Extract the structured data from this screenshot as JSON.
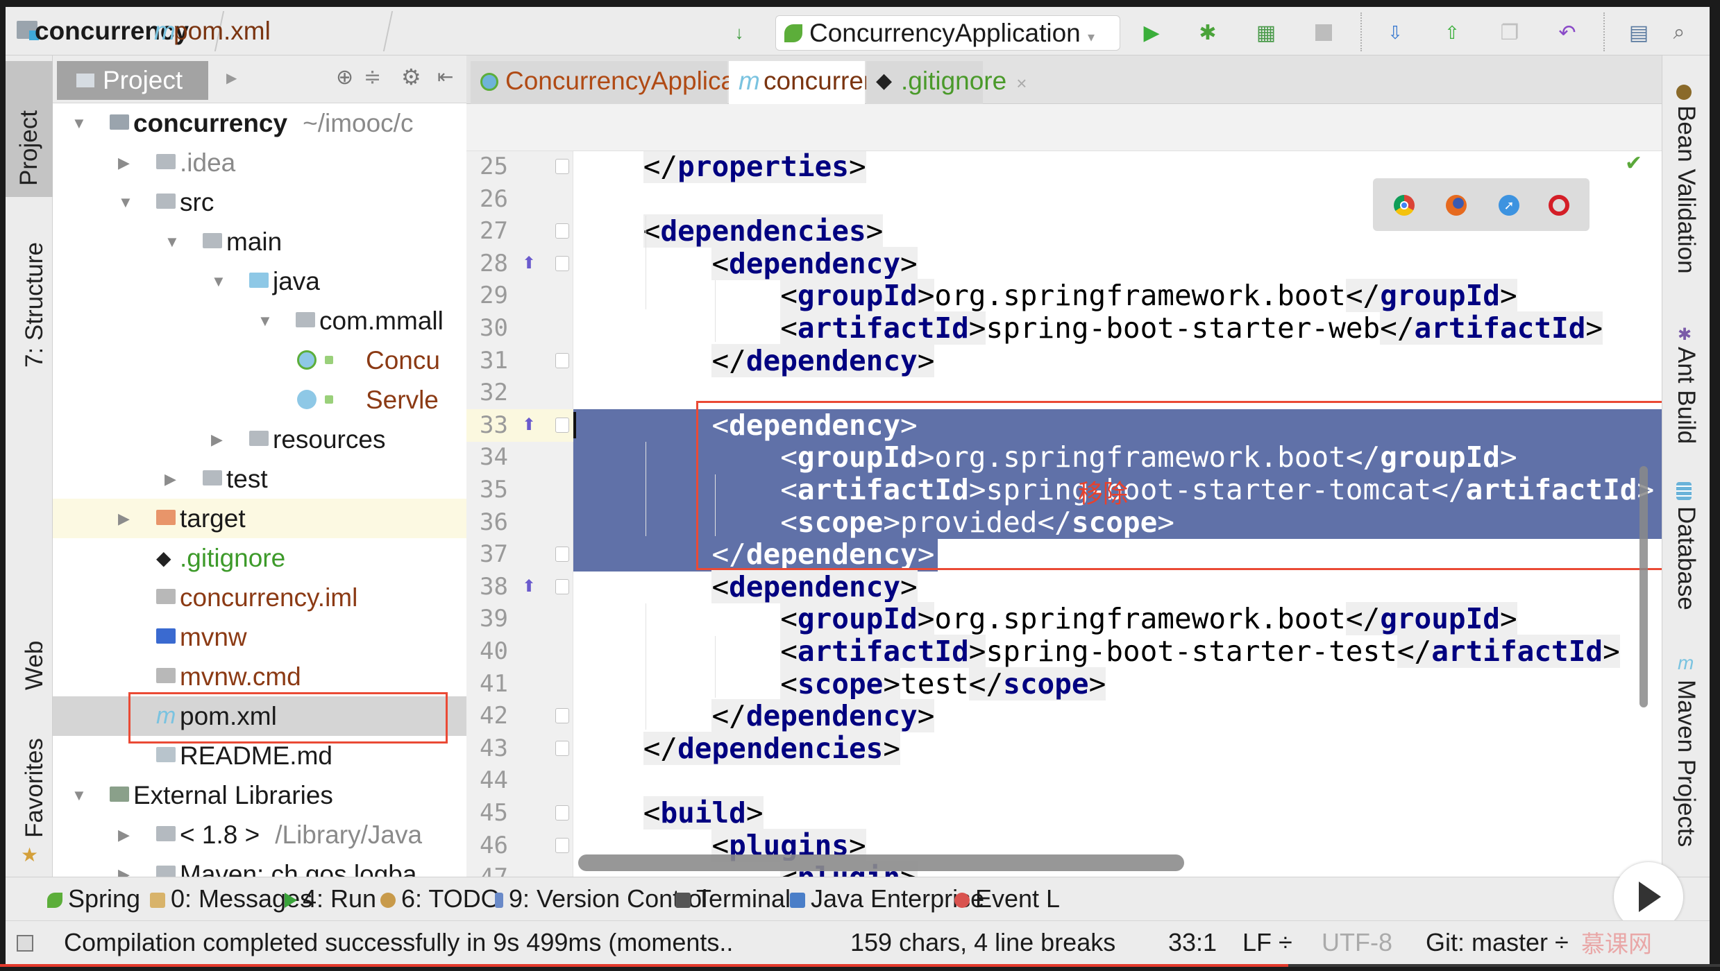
{
  "toolbar": {
    "breadcrumb": [
      {
        "label": "concurrency",
        "icon": "module-folder-icon"
      },
      {
        "label": "pom.xml",
        "icon": "maven-m-icon"
      }
    ],
    "run_config": "ConcurrencyApplication",
    "icons": [
      "sort-icon",
      "run-icon",
      "debug-icon",
      "coverage-icon",
      "stop-icon",
      "vcs-update-icon",
      "vcs-commit-icon",
      "vcs-history-icon",
      "revert-icon",
      "project-structure-icon",
      "search-icon"
    ]
  },
  "left_strip": {
    "items": [
      {
        "label": "Project",
        "active": true
      },
      {
        "label": "7: Structure"
      },
      {
        "label": "Web"
      },
      {
        "label": "Favorites"
      }
    ]
  },
  "right_strip": {
    "items": [
      {
        "label": "Bean Validation"
      },
      {
        "label": "Ant Build"
      },
      {
        "label": "Database"
      },
      {
        "label": "Maven Projects"
      }
    ]
  },
  "project_panel": {
    "title": "Project",
    "tree": [
      {
        "label": "concurrency",
        "suffix": "~/imooc/c",
        "level": 0,
        "arrow": "down",
        "icon": "module",
        "bold": true
      },
      {
        "label": ".idea",
        "level": 1,
        "arrow": "right",
        "icon": "folder",
        "color": "#8a8a8a"
      },
      {
        "label": "src",
        "level": 1,
        "arrow": "down",
        "icon": "folder"
      },
      {
        "label": "main",
        "level": 2,
        "arrow": "down",
        "icon": "folder"
      },
      {
        "label": "java",
        "level": 3,
        "arrow": "down",
        "icon": "source-folder"
      },
      {
        "label": "com.mmall",
        "level": 4,
        "arrow": "down",
        "icon": "package"
      },
      {
        "label": "Concu",
        "level": 5,
        "icon": "spring-class",
        "color": "#8b3a14"
      },
      {
        "label": "Servle",
        "level": 5,
        "icon": "class",
        "color": "#8b3a14"
      },
      {
        "label": "resources",
        "level": 3,
        "arrow": "right",
        "icon": "resources-folder"
      },
      {
        "label": "test",
        "level": 2,
        "arrow": "right",
        "icon": "folder"
      },
      {
        "label": "target",
        "level": 1,
        "arrow": "right",
        "icon": "excluded-folder",
        "highlight": true
      },
      {
        "label": ".gitignore",
        "level": 1,
        "icon": "git",
        "color": "#3d9a2a"
      },
      {
        "label": "concurrency.iml",
        "level": 1,
        "icon": "file",
        "color": "#8b3a14"
      },
      {
        "label": "mvnw",
        "level": 1,
        "icon": "shell",
        "color": "#8b3a14"
      },
      {
        "label": "mvnw.cmd",
        "level": 1,
        "icon": "file",
        "color": "#8b3a14"
      },
      {
        "label": "pom.xml",
        "level": 1,
        "icon": "maven",
        "selected": true,
        "boxed": true
      },
      {
        "label": "README.md",
        "level": 1,
        "icon": "markdown"
      },
      {
        "label": "External Libraries",
        "level": 0,
        "arrow": "down",
        "icon": "libraries"
      },
      {
        "label": "< 1.8 >",
        "suffix": "/Library/Java",
        "level": 1,
        "arrow": "right",
        "icon": "jdk"
      },
      {
        "label": "Maven: ch.qos.logba",
        "level": 1,
        "arrow": "right",
        "icon": "folder"
      }
    ]
  },
  "editor": {
    "tabs": [
      {
        "label": "ConcurrencyApplication.java",
        "color": "#b04a14",
        "icon": "spring-class-icon"
      },
      {
        "label": "concurrency",
        "color": "#7a3410",
        "icon": "maven-m-icon",
        "active": true
      },
      {
        "label": ".gitignore",
        "color": "#4a9a2a",
        "icon": "git-icon"
      }
    ],
    "lines": [
      {
        "n": 25,
        "text": "    </properties>",
        "fold": true
      },
      {
        "n": 26,
        "text": ""
      },
      {
        "n": 27,
        "text": "    <dependencies>",
        "fold": true
      },
      {
        "n": 28,
        "text": "        <dependency>",
        "fold": true,
        "override": true
      },
      {
        "n": 29,
        "text": "            <groupId>org.springframework.boot</groupId>"
      },
      {
        "n": 30,
        "text": "            <artifactId>spring-boot-starter-web</artifactId>"
      },
      {
        "n": 31,
        "text": "        </dependency>",
        "fold": true
      },
      {
        "n": 32,
        "text": ""
      },
      {
        "n": 33,
        "text": "        <dependency>",
        "fold": true,
        "override": true,
        "selected": "full"
      },
      {
        "n": 34,
        "text": "            <groupId>org.springframework.boot</groupId>",
        "selected": "full"
      },
      {
        "n": 35,
        "text": "            <artifactId>spring-boot-starter-tomcat</artifactId>",
        "selected": "full"
      },
      {
        "n": 36,
        "text": "            <scope>provided</scope>",
        "selected": "full"
      },
      {
        "n": 37,
        "text": "        </dependency>",
        "fold": true,
        "selected": "text"
      },
      {
        "n": 38,
        "text": "        <dependency>",
        "fold": true,
        "override": true
      },
      {
        "n": 39,
        "text": "            <groupId>org.springframework.boot</groupId>"
      },
      {
        "n": 40,
        "text": "            <artifactId>spring-boot-starter-test</artifactId>"
      },
      {
        "n": 41,
        "text": "            <scope>test</scope>"
      },
      {
        "n": 42,
        "text": "        </dependency>",
        "fold": true
      },
      {
        "n": 43,
        "text": "    </dependencies>",
        "fold": true
      },
      {
        "n": 44,
        "text": ""
      },
      {
        "n": 45,
        "text": "    <build>",
        "fold": true
      },
      {
        "n": 46,
        "text": "        <plugins>",
        "fold": true
      },
      {
        "n": 47,
        "text": "            <plugin>"
      }
    ],
    "annotation": "移除",
    "annotation_color": "#e8412c",
    "selection_color": "#6071a8",
    "browser_icons": [
      "chrome-icon",
      "firefox-icon",
      "safari-icon",
      "opera-icon"
    ]
  },
  "bottom_tools": [
    {
      "label": "Spring",
      "icon": "spring-icon",
      "color": "#5cae3a"
    },
    {
      "label": "0: Messages",
      "mnemonic": "0",
      "icon": "messages-icon",
      "color": "#d8b36a"
    },
    {
      "label": "4: Run",
      "mnemonic": "4",
      "icon": "run-icon",
      "color": "#3aa33a"
    },
    {
      "label": "6: TODO",
      "mnemonic": "6",
      "icon": "todo-icon",
      "color": "#c89a4a"
    },
    {
      "label": "9: Version Control",
      "mnemonic": "9",
      "icon": "vcs-icon",
      "color": "#6a8ac8"
    },
    {
      "label": "Terminal",
      "icon": "terminal-icon",
      "color": "#555555"
    },
    {
      "label": "Java Enterprise",
      "icon": "java-enterprise-icon",
      "color": "#4a7ec8"
    },
    {
      "label": "Event L",
      "icon": "event-log-icon",
      "color": "#d9534f"
    }
  ],
  "status": {
    "message": "Compilation completed successfully in 9s 499ms (moments..",
    "selection_info": "159 chars, 4 line breaks",
    "position": "33:1",
    "line_separator": "LF ÷",
    "encoding": "UTF-8",
    "vcs_branch": "Git: master ÷",
    "watermark": "慕课网"
  },
  "video_progress": 0.749
}
